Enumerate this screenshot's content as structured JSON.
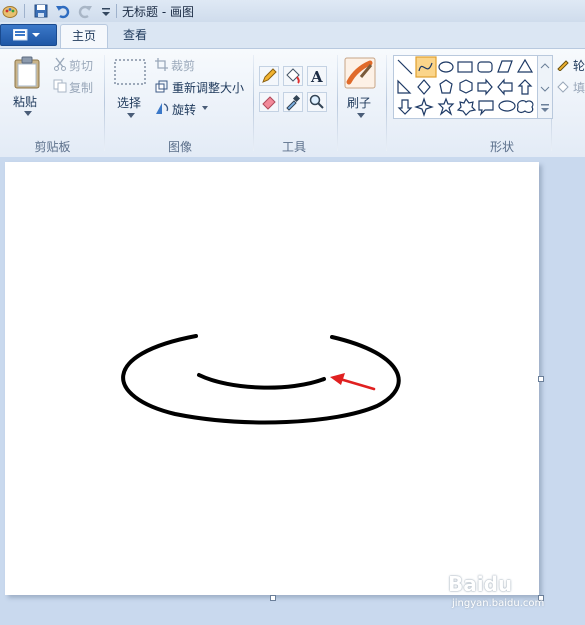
{
  "window": {
    "title": "无标题 - 画图"
  },
  "tabs": [
    {
      "label": "主页",
      "active": true
    },
    {
      "label": "查看",
      "active": false
    }
  ],
  "ribbon": {
    "clipboard": {
      "paste": "粘贴",
      "cut": "剪切",
      "copy": "复制",
      "group": "剪贴板"
    },
    "image": {
      "select": "选择",
      "crop": "裁剪",
      "resize": "重新调整大小",
      "rotate": "旋转",
      "group": "图像"
    },
    "tools": {
      "group": "工具"
    },
    "brushes": {
      "label": "刷子"
    },
    "shapes": {
      "group": "形状",
      "outline_partial": "轮",
      "fill_partial": "填"
    }
  },
  "watermark": {
    "brand": "Baidu",
    "sub": "jingyan.baidu.com"
  },
  "colors": {
    "accent_red": "#e02020",
    "stroke": "#000000",
    "canvas": "#ffffff"
  }
}
